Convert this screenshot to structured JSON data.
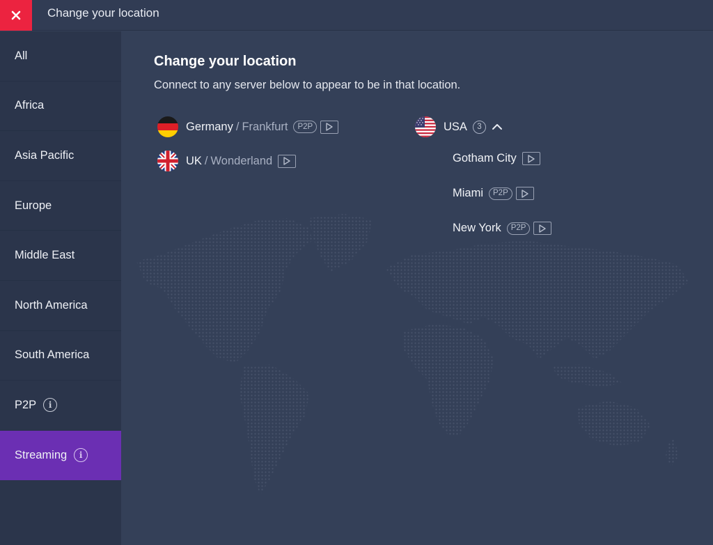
{
  "window": {
    "title": "Change your location",
    "close_icon": "close-icon",
    "accent_close": "#ec2340"
  },
  "sidebar": {
    "active_color": "#6b2fb3",
    "items": [
      {
        "label": "All",
        "info": false,
        "active": false
      },
      {
        "label": "Africa",
        "info": false,
        "active": false
      },
      {
        "label": "Asia Pacific",
        "info": false,
        "active": false
      },
      {
        "label": "Europe",
        "info": false,
        "active": false
      },
      {
        "label": "Middle East",
        "info": false,
        "active": false
      },
      {
        "label": "North America",
        "info": false,
        "active": false
      },
      {
        "label": "South America",
        "info": false,
        "active": false
      },
      {
        "label": "P2P",
        "info": true,
        "info_glyph": "i",
        "active": false
      },
      {
        "label": "Streaming",
        "info": true,
        "info_glyph": "i",
        "active": true
      }
    ]
  },
  "main": {
    "heading": "Change your location",
    "subheading": "Connect to any server below to appear to be in that location.",
    "locations": [
      {
        "country": "Germany",
        "separator": "/",
        "city": "Frankfurt",
        "flag": "germany-flag",
        "p2p": true,
        "p2p_label": "P2P",
        "streaming": true
      },
      {
        "country": "UK",
        "separator": "/",
        "city": "Wonderland",
        "flag": "uk-flag",
        "p2p": false,
        "streaming": true
      }
    ],
    "usa": {
      "country": "USA",
      "flag": "usa-flag",
      "count": "3",
      "expanded": true,
      "cities": [
        {
          "name": "Gotham City",
          "p2p": false,
          "streaming": true
        },
        {
          "name": "Miami",
          "p2p": true,
          "p2p_label": "P2P",
          "streaming": true
        },
        {
          "name": "New York",
          "p2p": true,
          "p2p_label": "P2P",
          "streaming": true
        }
      ]
    },
    "background": "world-map-dots"
  }
}
